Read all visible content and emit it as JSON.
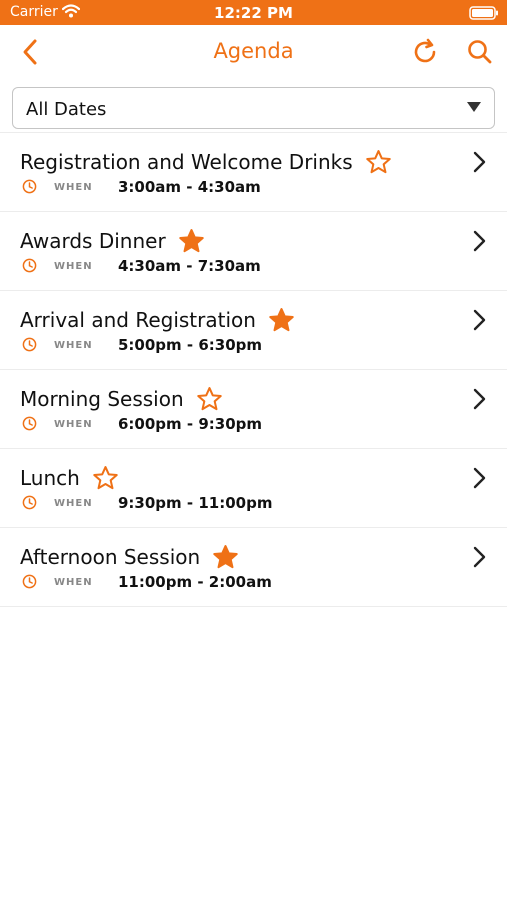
{
  "status_bar": {
    "carrier": "Carrier",
    "time": "12:22 PM"
  },
  "nav": {
    "title": "Agenda",
    "back_icon": "chevron-left-icon",
    "refresh_icon": "refresh-icon",
    "search_icon": "search-icon"
  },
  "filter": {
    "selected": "All Dates"
  },
  "colors": {
    "accent": "#ef7116"
  },
  "sessions": [
    {
      "title": "Registration and Welcome Drinks",
      "starred": false,
      "when_label": "WHEN",
      "when": "3:00am - 4:30am"
    },
    {
      "title": "Awards Dinner",
      "starred": true,
      "when_label": "WHEN",
      "when": "4:30am - 7:30am"
    },
    {
      "title": "Arrival and Registration",
      "starred": true,
      "when_label": "WHEN",
      "when": "5:00pm - 6:30pm"
    },
    {
      "title": "Morning Session",
      "starred": false,
      "when_label": "WHEN",
      "when": "6:00pm - 9:30pm"
    },
    {
      "title": "Lunch",
      "starred": false,
      "when_label": "WHEN",
      "when": "9:30pm - 11:00pm"
    },
    {
      "title": "Afternoon Session",
      "starred": true,
      "when_label": "WHEN",
      "when": "11:00pm - 2:00am"
    }
  ]
}
